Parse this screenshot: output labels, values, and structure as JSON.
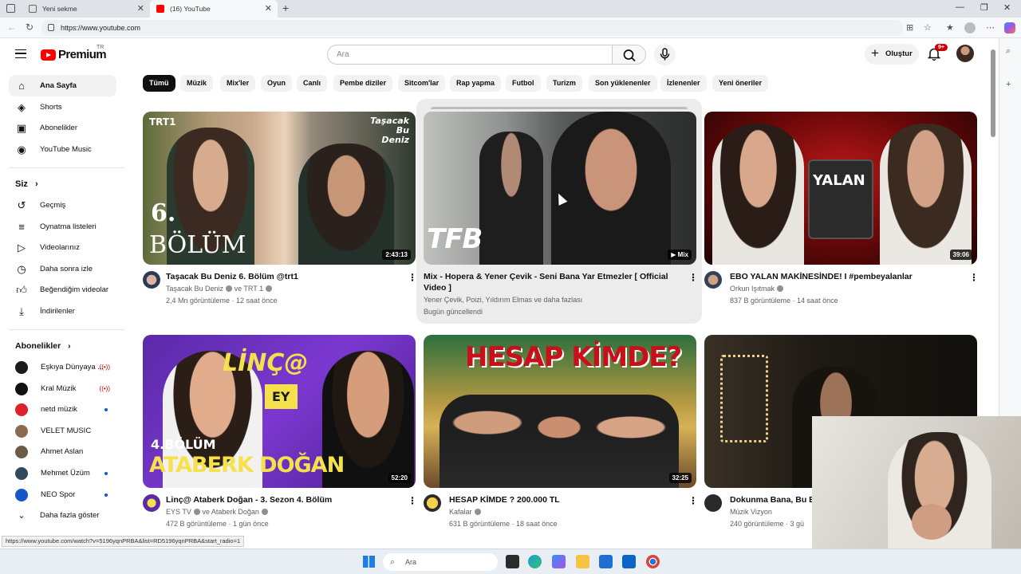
{
  "browser": {
    "tabs": [
      {
        "title": "Yeni sekme",
        "active": false
      },
      {
        "title": "(16) YouTube",
        "active": true
      }
    ],
    "url": "https://www.youtube.com",
    "status_url": "https://www.youtube.com/watch?v=5196yqnPRBA&list=RD5196yqnPRBA&start_radio=1"
  },
  "header": {
    "logo_text": "Premium",
    "country": "TR",
    "search_placeholder": "Ara",
    "create_label": "Oluştur",
    "notif_badge": "9+"
  },
  "sidebar": {
    "main": [
      {
        "label": "Ana Sayfa",
        "icon": "home-icon",
        "active": true
      },
      {
        "label": "Shorts",
        "icon": "shorts-icon"
      },
      {
        "label": "Abonelikler",
        "icon": "subscriptions-icon"
      },
      {
        "label": "YouTube Music",
        "icon": "music-icon"
      }
    ],
    "you_heading": "Siz",
    "you": [
      {
        "label": "Geçmiş",
        "icon": "history-icon"
      },
      {
        "label": "Oynatma listeleri",
        "icon": "playlists-icon"
      },
      {
        "label": "Videolarınız",
        "icon": "your-videos-icon"
      },
      {
        "label": "Daha sonra izle",
        "icon": "watch-later-icon"
      },
      {
        "label": "Beğendiğim videolar",
        "icon": "liked-icon"
      },
      {
        "label": "İndirilenler",
        "icon": "downloads-icon"
      }
    ],
    "subs_heading": "Abonelikler",
    "subs": [
      {
        "label": "Eşkıya Dünyaya ...",
        "indicator": "live",
        "color": "#1a1a1a"
      },
      {
        "label": "Kral Müzik",
        "indicator": "live",
        "color": "#111111"
      },
      {
        "label": "netd müzik",
        "indicator": "dot",
        "color": "#e0202a"
      },
      {
        "label": "VELET MUSIC",
        "indicator": "",
        "color": "#8a6a50"
      },
      {
        "label": "Ahmet Aslan",
        "indicator": "",
        "color": "#6b5a48"
      },
      {
        "label": "Mehmet Üzüm",
        "indicator": "dot",
        "color": "#2f4a5e"
      },
      {
        "label": "NEO Spor",
        "indicator": "dot",
        "color": "#1457c8"
      }
    ],
    "show_more": "Daha fazla göster"
  },
  "chips": [
    "Tümü",
    "Müzik",
    "Mix'ler",
    "Oyun",
    "Canlı",
    "Pembe diziler",
    "Sitcom'lar",
    "Rap yapma",
    "Futbol",
    "Turizm",
    "Son yüklenenler",
    "İzlenenler",
    "Yeni öneriler"
  ],
  "videos": [
    {
      "title": "Taşacak Bu Deniz 6. Bölüm @trt1",
      "channel": "Taşacak Bu Deniz",
      "channel_extra": "ve TRT 1",
      "meta": "2,4 Mn görüntüleme · 12 saat önce",
      "duration": "2:43:13",
      "overlay": {
        "episode": "6.",
        "bolum": "BÖLÜM",
        "logo": "TRT1",
        "show": "Taşacak Bu Deniz"
      }
    },
    {
      "title": "Mix - Hopera & Yener Çevik - Seni Bana Yar Etmezler [ Official Video ]",
      "channel": "Yener Çevik, Poizi, Yıldırım Elmas ve daha fazlası",
      "meta": "Bugün güncellendi",
      "duration": "Mix",
      "overlay": {
        "logo": "TFB"
      }
    },
    {
      "title": "EBO YALAN MAKİNESİNDE! I #pembeyalanlar",
      "channel": "Orkun Işıtmak",
      "meta": "837 B görüntüleme · 14 saat önce",
      "duration": "39:06",
      "overlay": {
        "word": "YALAN"
      }
    },
    {
      "title": "Linç@ Ataberk Doğan - 3. Sezon 4. Bölüm",
      "channel": "EYS TV",
      "channel_extra": "ve Ataberk Doğan",
      "meta": "472 B görüntüleme · 1 gün önce",
      "duration": "52:20",
      "overlay": {
        "logo": "LİNÇ@",
        "ep": "4.BÖLÜM",
        "name": "ATABERK DOĞAN",
        "badge": "EY"
      }
    },
    {
      "title": "HESAP KİMDE ? 200.000 TL",
      "channel": "Kafalar",
      "meta": "631 B görüntüleme · 18 saat önce",
      "duration": "32:25",
      "overlay": {
        "headline": "HESAP KİMDE?"
      }
    },
    {
      "title": "Dokunma Bana, Bu Bi",
      "channel": "Müzik Vizyon",
      "meta": "240 görüntüleme · 3 gü",
      "duration": ""
    }
  ],
  "taskbar": {
    "search_label": "Ara"
  },
  "colors": {
    "brand_red": "#ff0000",
    "chip_active": "#0f0f0f",
    "chip_bg": "#f2f2f2",
    "meta_gray": "#606060"
  }
}
